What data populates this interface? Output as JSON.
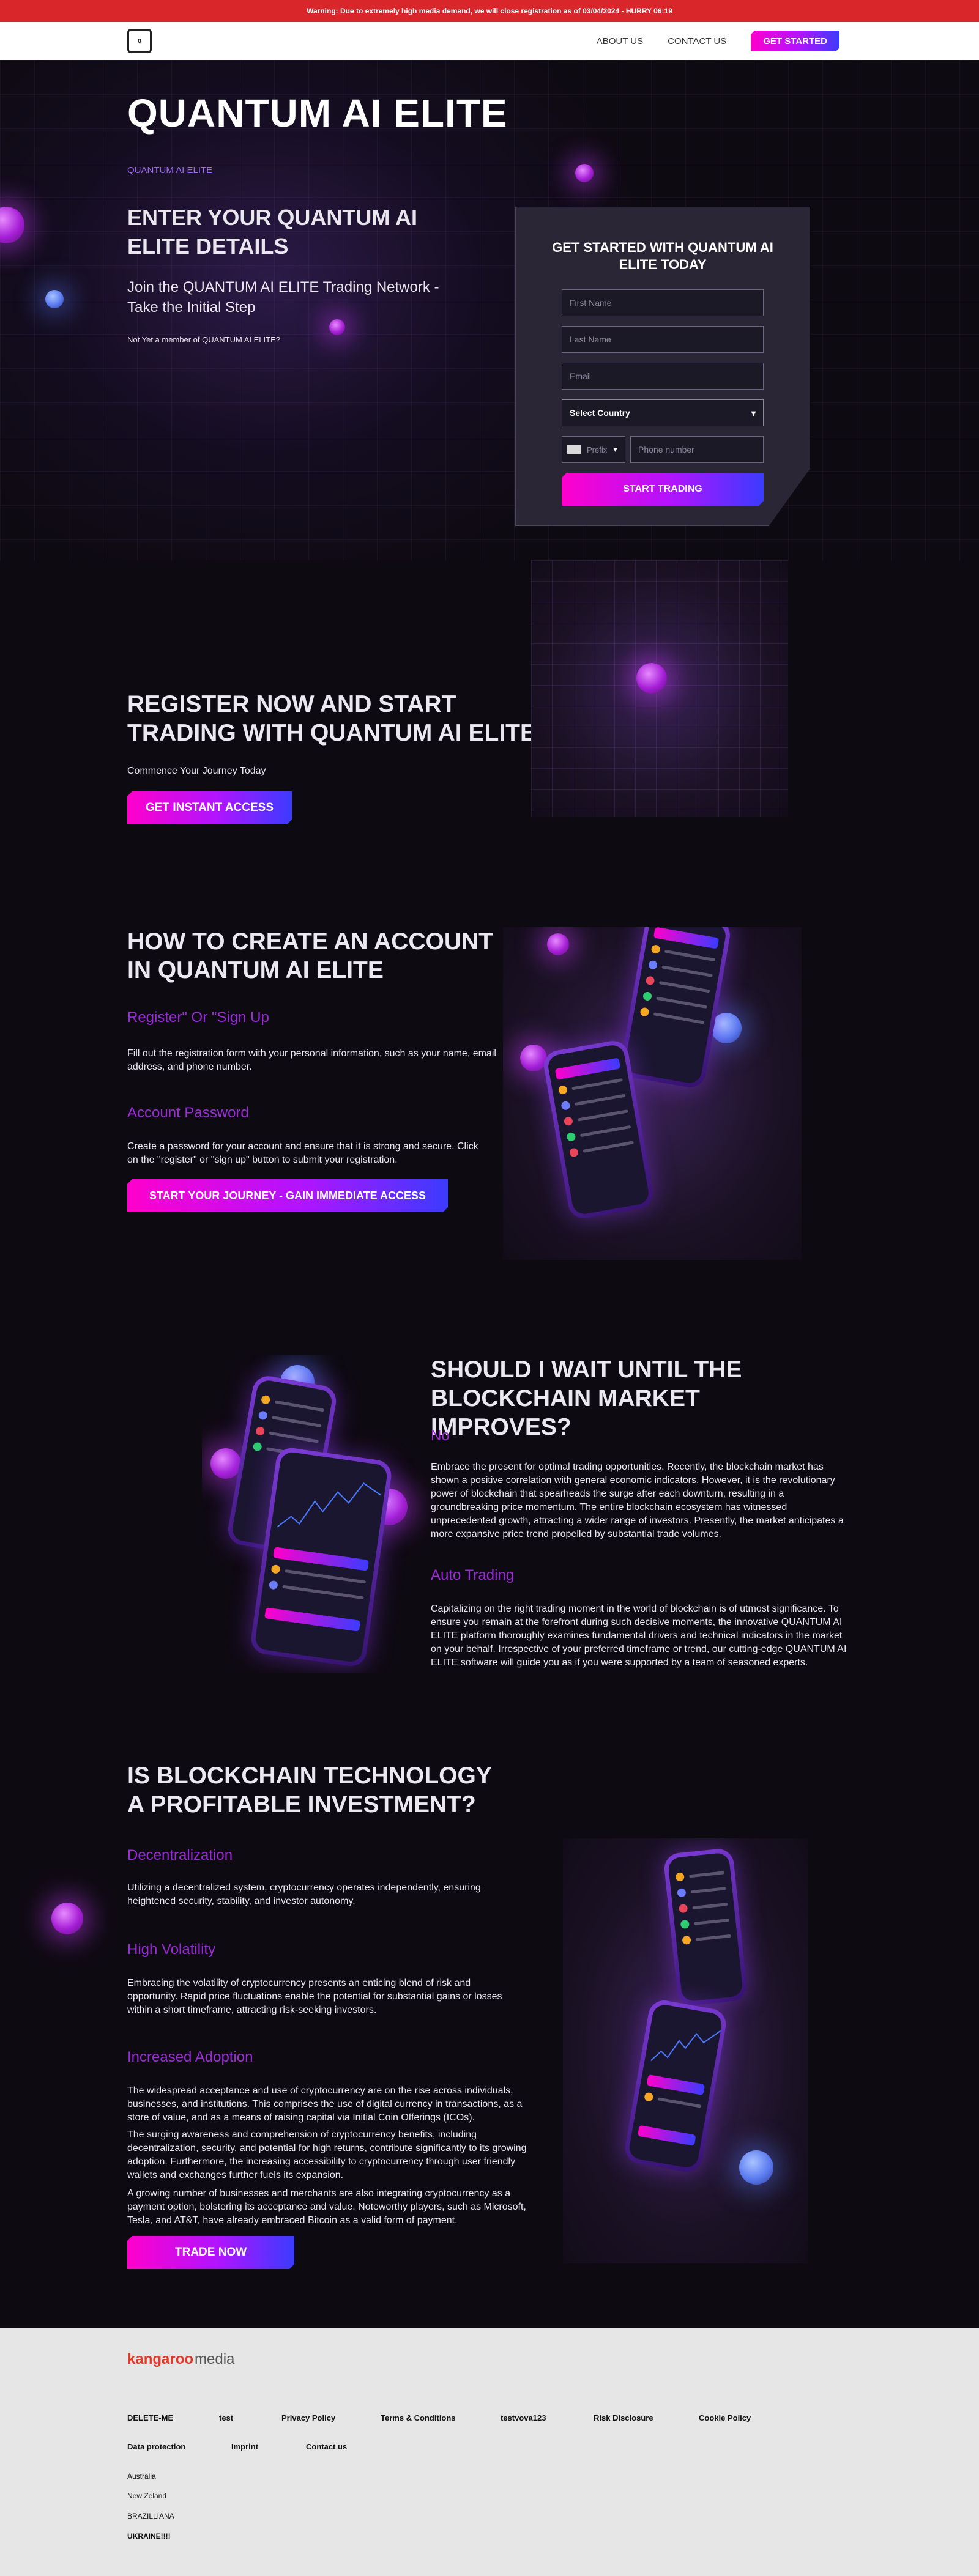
{
  "warning": "Warning: Due to extremely high media demand, we will close registration as of 03/04/2024 - HURRY 06:19",
  "nav": {
    "logo_text": "Q",
    "links": [
      "ABOUT US",
      "CONTACT US"
    ],
    "cta": "GET STARTED"
  },
  "hero": {
    "title": "QUANTUM AI ELITE",
    "small": "QUANTUM AI ELITE",
    "subtitle": "ENTER YOUR QUANTUM AI ELITE DETAILS",
    "text": "Join the QUANTUM AI ELITE Trading Network - Take the Initial Step",
    "note": "Not Yet a member of QUANTUM AI ELITE?"
  },
  "form": {
    "title": "GET STARTED WITH QUANTUM AI ELITE TODAY",
    "first_name": "First Name",
    "last_name": "Last Name",
    "email": "Email",
    "country": "Select Country",
    "prefix": "Prefix",
    "phone": "Phone number",
    "submit": "START TRADING"
  },
  "register": {
    "title": "REGISTER NOW AND START TRADING WITH QUANTUM AI ELITE",
    "text": "Commence Your Journey Today",
    "cta": "GET INSTANT ACCESS"
  },
  "howto": {
    "title": "HOW TO CREATE AN ACCOUNT IN QUANTUM AI ELITE",
    "step1_title": "Register\" Or \"Sign Up",
    "step1_text": "Fill out the registration form with your personal information, such as your name, email address, and phone number.",
    "step2_title": "Account Password",
    "step2_text": "Create a password for your account and ensure that it is strong and secure. Click on the \"register\" or \"sign up\" button to submit your registration.",
    "cta": "START YOUR JOURNEY - GAIN IMMEDIATE ACCESS"
  },
  "wait": {
    "title": "SHOULD I WAIT UNTIL THE BLOCKCHAIN MARKET IMPROVES?",
    "sub1": "No",
    "text1": "Embrace the present for optimal trading opportunities. Recently, the blockchain market has shown a positive correlation with general economic indicators. However, it is the revolutionary power of blockchain that spearheads the surge after each downturn, resulting in a groundbreaking price momentum. The entire blockchain ecosystem has witnessed unprecedented growth, attracting a wider range of investors. Presently, the market anticipates a more expansive price trend propelled by substantial trade volumes.",
    "sub2": "Auto Trading",
    "text2": "Capitalizing on the right trading moment in the world of blockchain is of utmost significance. To ensure you remain at the forefront during such decisive moments, the innovative QUANTUM AI ELITE platform thoroughly examines fundamental drivers and technical indicators in the market on your behalf. Irrespective of your preferred timeframe or trend, our cutting-edge QUANTUM AI ELITE software will guide you as if you were supported by a team of seasoned experts."
  },
  "profit": {
    "title": "IS BLOCKCHAIN TECHNOLOGY A PROFITABLE INVESTMENT?",
    "sub1": "Decentralization",
    "text1": "Utilizing a decentralized system, cryptocurrency operates independently, ensuring heightened security, stability, and investor autonomy.",
    "sub2": "High Volatility",
    "text2": "Embracing the volatility of cryptocurrency presents an enticing blend of risk and opportunity. Rapid price fluctuations enable the potential for substantial gains or losses within a short timeframe, attracting risk-seeking investors.",
    "sub3": "Increased Adoption",
    "text3": "The widespread acceptance and use of cryptocurrency are on the rise across individuals, businesses, and institutions. This comprises the use of digital currency in transactions, as a store of value, and as a means of raising capital via Initial Coin Offerings (ICOs).",
    "text4": "The surging awareness and comprehension of cryptocurrency benefits, including decentralization, security, and potential for high returns, contribute significantly to its growing adoption. Furthermore, the increasing accessibility to cryptocurrency through user friendly wallets and exchanges further fuels its expansion.",
    "text5": "A growing number of businesses and merchants are also integrating cryptocurrency as a payment option, bolstering its acceptance and value. Noteworthy players, such as Microsoft, Tesla, and AT&T, have already embraced Bitcoin as a valid form of payment.",
    "cta": "TRADE NOW"
  },
  "footer": {
    "logo_a": "kangaroo",
    "logo_b": "media",
    "links_row1": [
      "DELETE-ME",
      "test",
      "Privacy Policy",
      "Terms & Conditions",
      "testvova123",
      "Risk Disclosure",
      "Cookie Policy"
    ],
    "links_row2": [
      "Data protection",
      "Imprint",
      "Contact us"
    ],
    "countries": [
      "Australia",
      "New Zeland",
      "BRAZILLIANA",
      "UKRAINE!!!!"
    ]
  },
  "colors": {
    "accent_pink": "#ff00cc",
    "accent_blue": "#3b3bff",
    "warning_red": "#d8262b",
    "sub_purple": "#9b2bd8"
  }
}
